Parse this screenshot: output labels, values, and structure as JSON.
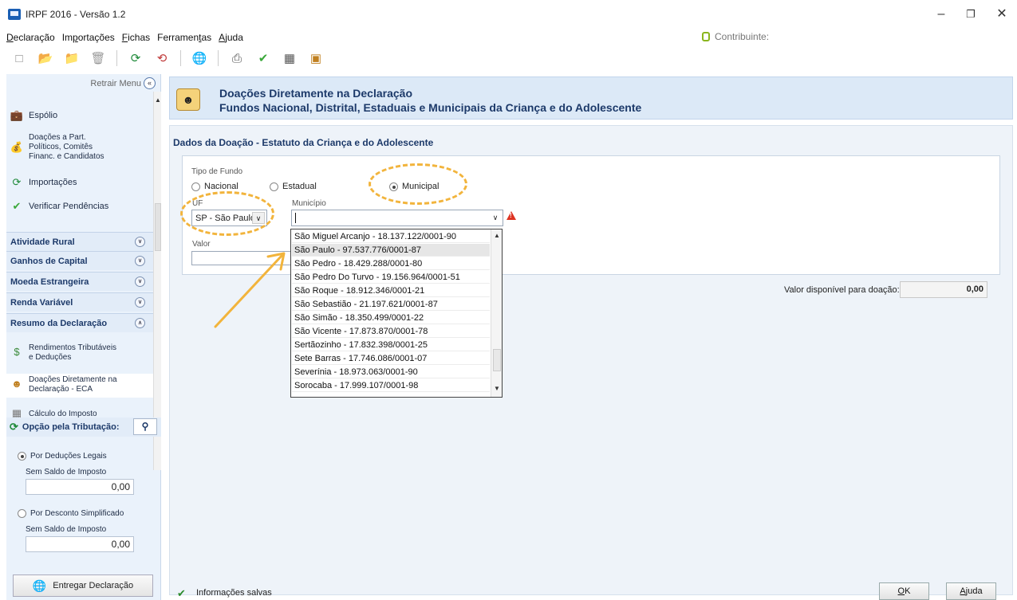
{
  "window": {
    "title": "IRPF 2016 - Versão 1.2",
    "minimize": "–",
    "maximize": "❐",
    "close": "✕"
  },
  "menu": {
    "items": [
      {
        "pre": "",
        "u": "D",
        "post": "eclaração"
      },
      {
        "pre": "Im",
        "u": "p",
        "post": "ortações"
      },
      {
        "pre": "",
        "u": "F",
        "post": "ichas"
      },
      {
        "pre": "Ferramen",
        "u": "t",
        "post": "as"
      },
      {
        "pre": "",
        "u": "A",
        "post": "juda"
      }
    ],
    "contribuinte": "Contribuinte:"
  },
  "sidebar": {
    "retrair": "Retrair Menu",
    "items": [
      {
        "label": "Espólio",
        "icon": "suitcase-icon"
      },
      {
        "label_lines": [
          "Doações a Part.",
          "Políticos, Comitês",
          "Financ. e Candidatos"
        ],
        "icon": "money-bag-icon"
      },
      {
        "label": "Importações",
        "icon": "import-icon"
      },
      {
        "label": "Verificar Pendências",
        "icon": "check-icon"
      }
    ],
    "categories": [
      "Atividade Rural",
      "Ganhos de Capital",
      "Moeda Estrangeira",
      "Renda Variável",
      "Resumo da Declaração"
    ],
    "subitems": [
      {
        "label_lines": [
          "Rendimentos Tributáveis",
          "e Deduções"
        ],
        "icon": "money-icon"
      },
      {
        "label_lines": [
          "Doações Diretamente na",
          "Declaração - ECA"
        ],
        "icon": "children-icon"
      },
      {
        "label": "Cálculo do Imposto",
        "icon": "calc-icon"
      }
    ],
    "opcao_title": "Opção pela Tributação:",
    "opcao_deducoes": "Por Deduções Legais",
    "saldo_label_1": "Sem Saldo de Imposto",
    "saldo_value_1": "0,00",
    "opcao_simplificado": "Por Desconto Simplificado",
    "saldo_label_2": "Sem Saldo de Imposto",
    "saldo_value_2": "0,00",
    "entregar": "Entregar Declaração"
  },
  "header": {
    "line1": "Doações Diretamente na Declaração",
    "line2": "Fundos Nacional, Distrital, Estaduais e Municipais da Criança e do Adolescente"
  },
  "form": {
    "section_title": "Dados da Doação - Estatuto da Criança e do Adolescente",
    "tipo_fundo_label": "Tipo de Fundo",
    "radio_nacional": "Nacional",
    "radio_estadual": "Estadual",
    "radio_municipal": "Municipal",
    "selected_tipo": "Municipal",
    "uf_label": "UF",
    "uf_value": "SP - São Paulo",
    "municipio_label": "Município",
    "municipio_value": "",
    "valor_label": "Valor",
    "valor_value": "",
    "municipio_options": [
      "São Miguel Arcanjo - 18.137.122/0001-90",
      "São Paulo - 97.537.776/0001-87",
      "São Pedro - 18.429.288/0001-80",
      "São Pedro Do Turvo - 19.156.964/0001-51",
      "São Roque - 18.912.346/0001-21",
      "São Sebastião - 21.197.621/0001-87",
      "São Simão - 18.350.499/0001-22",
      "São Vicente - 17.873.870/0001-78",
      "Sertãozinho - 17.832.398/0001-25",
      "Sete Barras - 17.746.086/0001-07",
      "Severínia - 18.973.063/0001-90",
      "Sorocaba - 17.999.107/0001-98"
    ],
    "highlighted_option": "São Paulo - 97.537.776/0001-87",
    "disponivel_label": "Valor disponível para doação:",
    "disponivel_value": "0,00"
  },
  "footer": {
    "info_salvas": "Informações salvas",
    "ok_u": "O",
    "ok_rest": "K",
    "ajuda_u": "A",
    "ajuda_rest": "juda"
  },
  "colors": {
    "accent": "#1d3a6a",
    "annotation": "#f2b43c",
    "warning": "#dd3322"
  }
}
